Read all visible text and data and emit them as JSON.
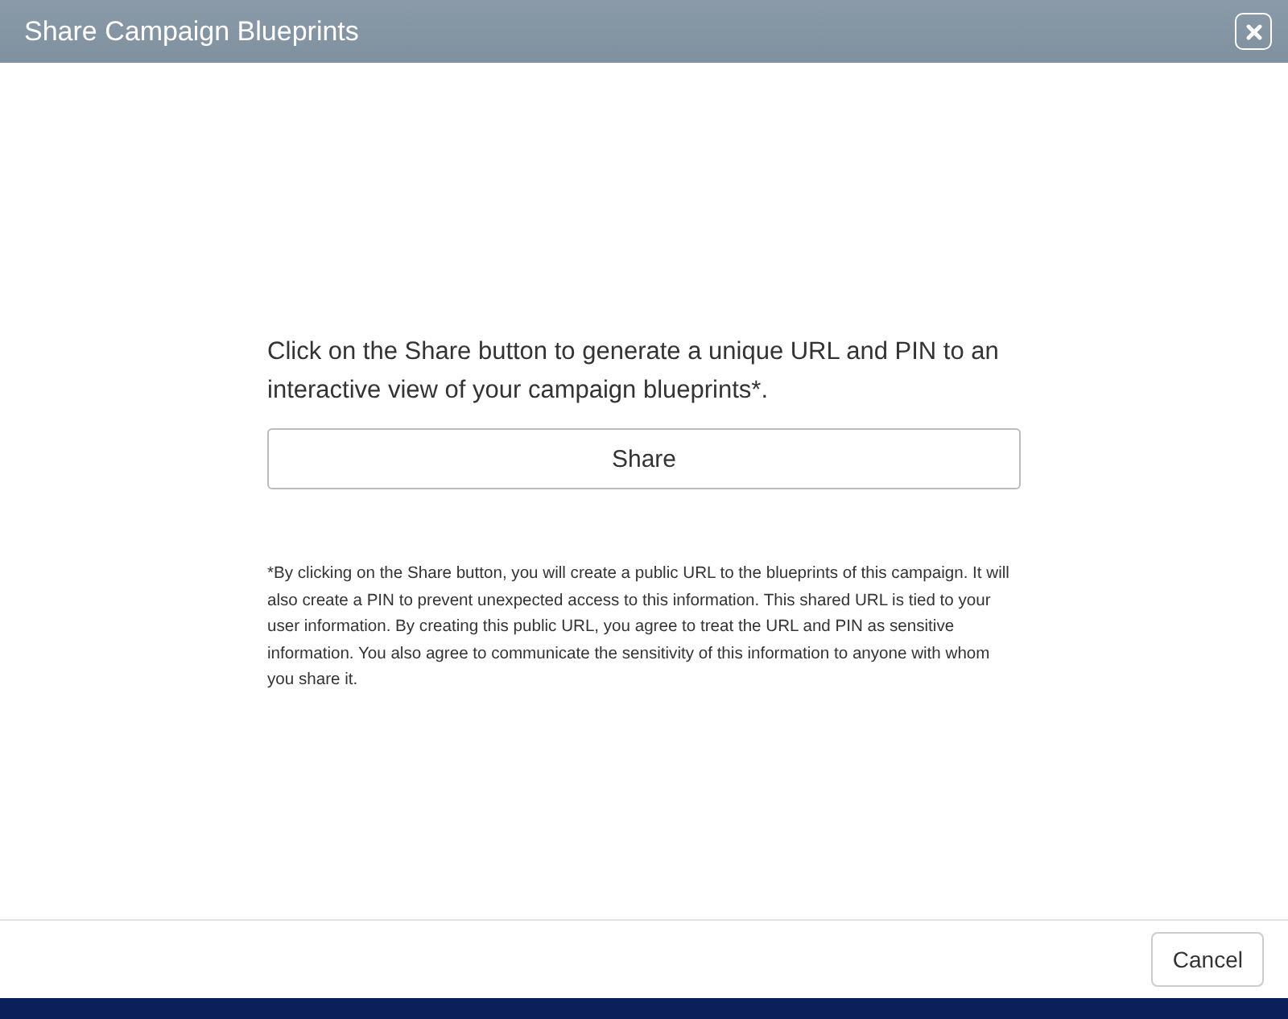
{
  "window": {
    "title": "Share Campaign Blueprints"
  },
  "intro": "Click on the Share button to generate a unique URL and PIN to an interactive view of your campaign blueprints*.",
  "share_button": "Share",
  "disclaimer": "*By clicking on the Share button, you will create a public URL to the blueprints of this campaign. It will also create a PIN to prevent unexpected access to this information. This shared URL is tied to your user information. By creating this public URL, you agree to treat the URL and PIN as sensitive information. You also agree to communicate the sensitivity of this information to anyone with whom you share it.",
  "footer": {
    "buttons": [
      "Cancel"
    ]
  }
}
